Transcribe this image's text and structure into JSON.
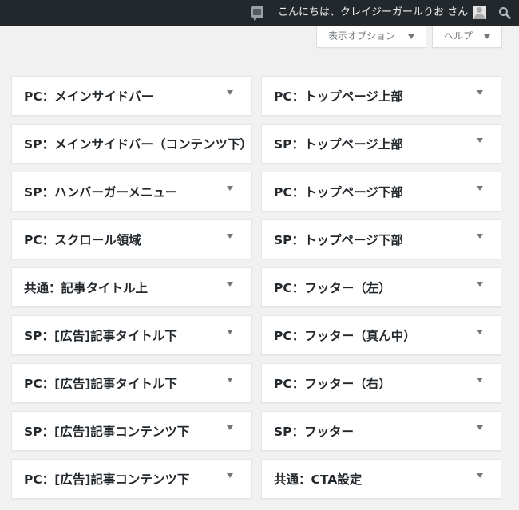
{
  "admin_bar": {
    "greeting": "こんにちは、クレイジーガールりお さん",
    "icons": [
      "comment-icon",
      "avatar",
      "search-icon"
    ]
  },
  "screen_meta": {
    "options_label": "表示オプション",
    "help_label": "ヘルプ"
  },
  "sidebars": {
    "left": [
      "PC：メインサイドバー",
      "SP：メインサイドバー（コンテンツ下）",
      "SP：ハンバーガーメニュー",
      "PC：スクロール領域",
      "共通：記事タイトル上",
      "SP：[広告]記事タイトル下",
      "PC：[広告]記事タイトル下",
      "SP：[広告]記事コンテンツ下",
      "PC：[広告]記事コンテンツ下"
    ],
    "right": [
      "PC：トップページ上部",
      "SP：トップページ上部",
      "PC：トップページ下部",
      "SP：トップページ下部",
      "PC：フッター（左）",
      "PC：フッター（真ん中）",
      "PC：フッター（右）",
      "SP：フッター",
      "共通：CTA設定"
    ]
  }
}
